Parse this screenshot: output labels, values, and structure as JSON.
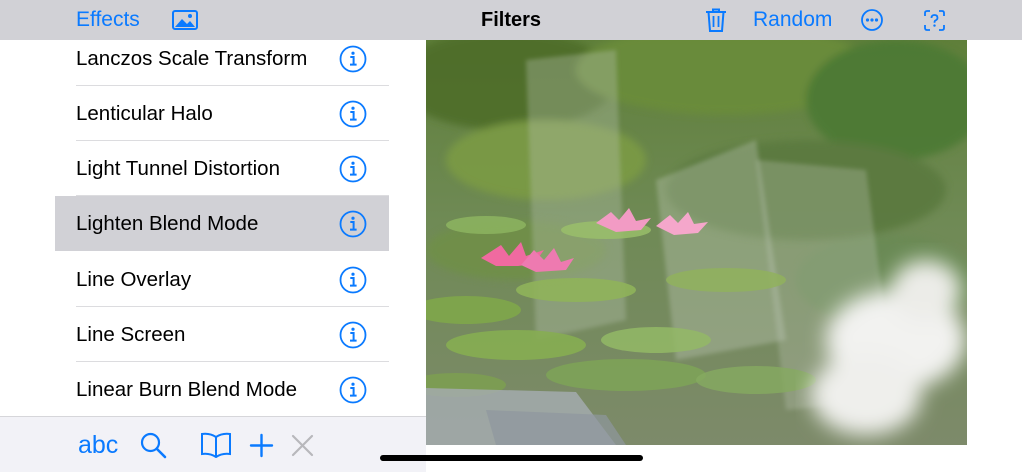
{
  "colors": {
    "accent": "#0a7aff",
    "navbar_bg": "#d1d1d6",
    "selected_row_bg": "#d1d1d6",
    "toolbar_bg": "#f2f2f7",
    "disabled": "#b8b8bc"
  },
  "navbar": {
    "effects_label": "Effects",
    "photo_icon": "photo-icon",
    "title": "Filters",
    "trash_icon": "trash-icon",
    "random_label": "Random",
    "more_icon": "ellipsis-circle-icon",
    "help_icon": "questionmark-square-icon"
  },
  "filter_list": {
    "items": [
      {
        "label": "Lanczos Scale Transform",
        "selected": false
      },
      {
        "label": "Lenticular Halo",
        "selected": false
      },
      {
        "label": "Light Tunnel Distortion",
        "selected": false
      },
      {
        "label": "Lighten Blend Mode",
        "selected": true
      },
      {
        "label": "Line Overlay",
        "selected": false
      },
      {
        "label": "Line Screen",
        "selected": false
      },
      {
        "label": "Linear Burn Blend Mode",
        "selected": false
      }
    ],
    "info_icon": "info-circle-icon"
  },
  "preview": {
    "content": "filtered photo of a lily pond with pink water lilies"
  },
  "toolbar": {
    "abc_label": "abc",
    "search_icon": "search-icon",
    "book_icon": "book-icon",
    "add_icon": "plus-icon",
    "close_icon": "close-icon",
    "close_enabled": false
  }
}
